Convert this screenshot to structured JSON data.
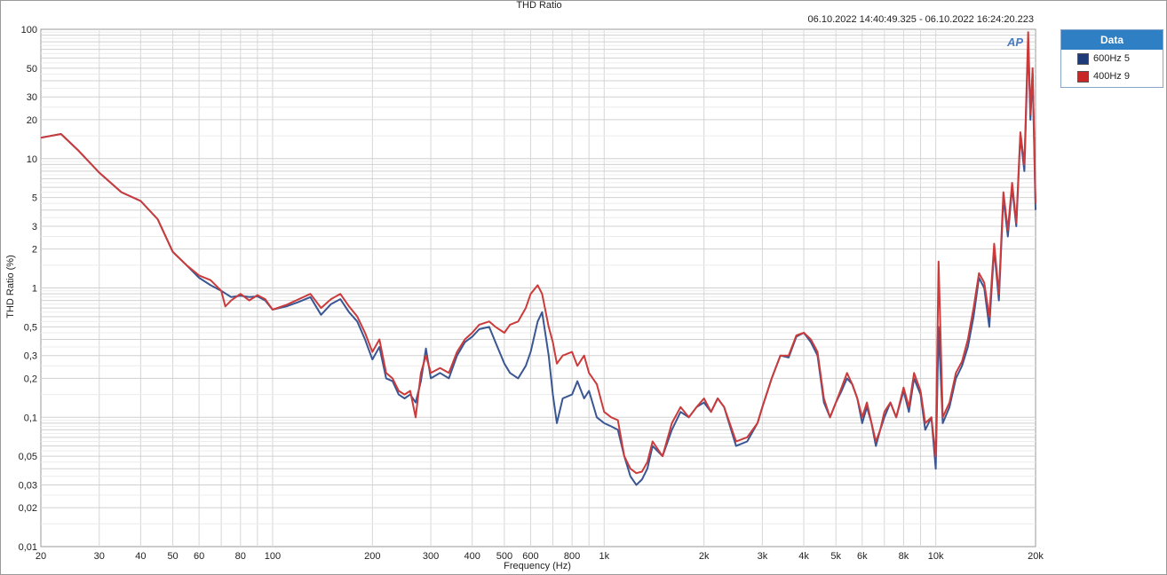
{
  "colors": {
    "series_blue": "#3a5693",
    "series_red": "#cc3b3b",
    "legend_header": "#2e7fc4"
  },
  "window": {
    "title": "THD Ratio",
    "date_range": "06.10.2022 14:40:49.325 - 06.10.2022 16:24:20.223"
  },
  "legend": {
    "title": "Data",
    "items": [
      {
        "label": "600Hz 5",
        "color": "#1f3b7a"
      },
      {
        "label": "400Hz 9",
        "color": "#c82828"
      }
    ]
  },
  "logo": "AP",
  "chart_data": {
    "type": "line",
    "title": "THD Ratio",
    "xlabel": "Frequency (Hz)",
    "ylabel": "THD Ratio (%)",
    "xscale": "log",
    "yscale": "log",
    "xlim": [
      20,
      20000
    ],
    "ylim": [
      0.01,
      100
    ],
    "grid": true,
    "legend_position": "right",
    "xticks": [
      {
        "value": 20,
        "label": "20"
      },
      {
        "value": 30,
        "label": "30"
      },
      {
        "value": 40,
        "label": "40"
      },
      {
        "value": 50,
        "label": "50"
      },
      {
        "value": 60,
        "label": "60"
      },
      {
        "value": 80,
        "label": "80"
      },
      {
        "value": 100,
        "label": "100"
      },
      {
        "value": 200,
        "label": "200"
      },
      {
        "value": 300,
        "label": "300"
      },
      {
        "value": 400,
        "label": "400"
      },
      {
        "value": 500,
        "label": "500"
      },
      {
        "value": 600,
        "label": "600"
      },
      {
        "value": 800,
        "label": "800"
      },
      {
        "value": 1000,
        "label": "1k"
      },
      {
        "value": 2000,
        "label": "2k"
      },
      {
        "value": 3000,
        "label": "3k"
      },
      {
        "value": 4000,
        "label": "4k"
      },
      {
        "value": 5000,
        "label": "5k"
      },
      {
        "value": 6000,
        "label": "6k"
      },
      {
        "value": 8000,
        "label": "8k"
      },
      {
        "value": 10000,
        "label": "10k"
      },
      {
        "value": 20000,
        "label": "20k"
      }
    ],
    "yticks": [
      {
        "value": 100,
        "label": "100"
      },
      {
        "value": 50,
        "label": "50"
      },
      {
        "value": 30,
        "label": "30"
      },
      {
        "value": 20,
        "label": "20"
      },
      {
        "value": 10,
        "label": "10"
      },
      {
        "value": 5,
        "label": "5"
      },
      {
        "value": 3,
        "label": "3"
      },
      {
        "value": 2,
        "label": "2"
      },
      {
        "value": 1,
        "label": "1"
      },
      {
        "value": 0.5,
        "label": "0,5"
      },
      {
        "value": 0.3,
        "label": "0,3"
      },
      {
        "value": 0.2,
        "label": "0,2"
      },
      {
        "value": 0.1,
        "label": "0,1"
      },
      {
        "value": 0.05,
        "label": "0,05"
      },
      {
        "value": 0.03,
        "label": "0,03"
      },
      {
        "value": 0.02,
        "label": "0,02"
      },
      {
        "value": 0.01,
        "label": "0,01"
      }
    ],
    "series": [
      {
        "name": "600Hz 5",
        "color": "#3a5693",
        "points": [
          [
            20,
            14.5
          ],
          [
            23,
            15.5
          ],
          [
            26,
            11.5
          ],
          [
            30,
            7.8
          ],
          [
            35,
            5.5
          ],
          [
            40,
            4.7
          ],
          [
            45,
            3.4
          ],
          [
            50,
            1.9
          ],
          [
            55,
            1.5
          ],
          [
            60,
            1.2
          ],
          [
            65,
            1.05
          ],
          [
            70,
            0.95
          ],
          [
            75,
            0.85
          ],
          [
            80,
            0.87
          ],
          [
            85,
            0.85
          ],
          [
            90,
            0.86
          ],
          [
            95,
            0.8
          ],
          [
            100,
            0.68
          ],
          [
            110,
            0.72
          ],
          [
            120,
            0.78
          ],
          [
            130,
            0.85
          ],
          [
            140,
            0.62
          ],
          [
            150,
            0.75
          ],
          [
            160,
            0.82
          ],
          [
            170,
            0.65
          ],
          [
            180,
            0.55
          ],
          [
            190,
            0.4
          ],
          [
            200,
            0.28
          ],
          [
            210,
            0.35
          ],
          [
            220,
            0.2
          ],
          [
            230,
            0.19
          ],
          [
            240,
            0.15
          ],
          [
            250,
            0.14
          ],
          [
            260,
            0.15
          ],
          [
            270,
            0.13
          ],
          [
            280,
            0.19
          ],
          [
            290,
            0.34
          ],
          [
            300,
            0.2
          ],
          [
            320,
            0.22
          ],
          [
            340,
            0.2
          ],
          [
            360,
            0.3
          ],
          [
            380,
            0.38
          ],
          [
            400,
            0.42
          ],
          [
            420,
            0.48
          ],
          [
            450,
            0.5
          ],
          [
            470,
            0.38
          ],
          [
            500,
            0.26
          ],
          [
            520,
            0.22
          ],
          [
            550,
            0.2
          ],
          [
            580,
            0.25
          ],
          [
            600,
            0.32
          ],
          [
            630,
            0.55
          ],
          [
            650,
            0.65
          ],
          [
            680,
            0.3
          ],
          [
            700,
            0.15
          ],
          [
            720,
            0.09
          ],
          [
            750,
            0.14
          ],
          [
            800,
            0.15
          ],
          [
            830,
            0.19
          ],
          [
            870,
            0.14
          ],
          [
            900,
            0.16
          ],
          [
            950,
            0.1
          ],
          [
            1000,
            0.09
          ],
          [
            1050,
            0.085
          ],
          [
            1100,
            0.08
          ],
          [
            1150,
            0.05
          ],
          [
            1200,
            0.035
          ],
          [
            1250,
            0.03
          ],
          [
            1300,
            0.033
          ],
          [
            1350,
            0.04
          ],
          [
            1400,
            0.06
          ],
          [
            1500,
            0.05
          ],
          [
            1600,
            0.08
          ],
          [
            1700,
            0.11
          ],
          [
            1800,
            0.1
          ],
          [
            1900,
            0.12
          ],
          [
            2000,
            0.13
          ],
          [
            2100,
            0.11
          ],
          [
            2200,
            0.14
          ],
          [
            2300,
            0.12
          ],
          [
            2500,
            0.06
          ],
          [
            2700,
            0.065
          ],
          [
            2900,
            0.09
          ],
          [
            3000,
            0.12
          ],
          [
            3200,
            0.2
          ],
          [
            3400,
            0.3
          ],
          [
            3600,
            0.29
          ],
          [
            3800,
            0.42
          ],
          [
            4000,
            0.45
          ],
          [
            4200,
            0.38
          ],
          [
            4400,
            0.3
          ],
          [
            4600,
            0.13
          ],
          [
            4800,
            0.1
          ],
          [
            5000,
            0.13
          ],
          [
            5200,
            0.16
          ],
          [
            5400,
            0.2
          ],
          [
            5600,
            0.18
          ],
          [
            5800,
            0.14
          ],
          [
            6000,
            0.09
          ],
          [
            6200,
            0.12
          ],
          [
            6400,
            0.09
          ],
          [
            6600,
            0.06
          ],
          [
            6800,
            0.08
          ],
          [
            7000,
            0.1
          ],
          [
            7300,
            0.13
          ],
          [
            7600,
            0.1
          ],
          [
            8000,
            0.16
          ],
          [
            8300,
            0.11
          ],
          [
            8600,
            0.2
          ],
          [
            9000,
            0.15
          ],
          [
            9300,
            0.08
          ],
          [
            9700,
            0.1
          ],
          [
            10000,
            0.04
          ],
          [
            10200,
            0.5
          ],
          [
            10500,
            0.09
          ],
          [
            11000,
            0.12
          ],
          [
            11500,
            0.2
          ],
          [
            12000,
            0.25
          ],
          [
            12500,
            0.35
          ],
          [
            13000,
            0.6
          ],
          [
            13500,
            1.2
          ],
          [
            14000,
            1.0
          ],
          [
            14500,
            0.5
          ],
          [
            15000,
            2.0
          ],
          [
            15500,
            0.8
          ],
          [
            16000,
            5.0
          ],
          [
            16500,
            2.5
          ],
          [
            17000,
            6.0
          ],
          [
            17500,
            3.0
          ],
          [
            18000,
            15.0
          ],
          [
            18500,
            8.0
          ],
          [
            19000,
            80.0
          ],
          [
            19300,
            20.0
          ],
          [
            19600,
            45.0
          ],
          [
            20000,
            4.0
          ]
        ]
      },
      {
        "name": "400Hz 9",
        "color": "#cc3b3b",
        "points": [
          [
            20,
            14.5
          ],
          [
            23,
            15.5
          ],
          [
            26,
            11.5
          ],
          [
            30,
            7.8
          ],
          [
            35,
            5.5
          ],
          [
            40,
            4.7
          ],
          [
            45,
            3.4
          ],
          [
            50,
            1.9
          ],
          [
            55,
            1.5
          ],
          [
            60,
            1.25
          ],
          [
            65,
            1.15
          ],
          [
            70,
            0.95
          ],
          [
            72,
            0.72
          ],
          [
            75,
            0.8
          ],
          [
            80,
            0.9
          ],
          [
            85,
            0.8
          ],
          [
            90,
            0.88
          ],
          [
            95,
            0.82
          ],
          [
            100,
            0.68
          ],
          [
            110,
            0.74
          ],
          [
            120,
            0.82
          ],
          [
            130,
            0.9
          ],
          [
            140,
            0.7
          ],
          [
            150,
            0.82
          ],
          [
            160,
            0.9
          ],
          [
            170,
            0.72
          ],
          [
            180,
            0.6
          ],
          [
            190,
            0.45
          ],
          [
            200,
            0.32
          ],
          [
            210,
            0.4
          ],
          [
            220,
            0.22
          ],
          [
            230,
            0.2
          ],
          [
            240,
            0.16
          ],
          [
            250,
            0.15
          ],
          [
            260,
            0.16
          ],
          [
            270,
            0.1
          ],
          [
            280,
            0.22
          ],
          [
            290,
            0.3
          ],
          [
            300,
            0.22
          ],
          [
            320,
            0.24
          ],
          [
            340,
            0.22
          ],
          [
            360,
            0.32
          ],
          [
            380,
            0.4
          ],
          [
            400,
            0.45
          ],
          [
            420,
            0.52
          ],
          [
            450,
            0.55
          ],
          [
            470,
            0.5
          ],
          [
            500,
            0.45
          ],
          [
            520,
            0.52
          ],
          [
            550,
            0.55
          ],
          [
            580,
            0.7
          ],
          [
            600,
            0.9
          ],
          [
            630,
            1.05
          ],
          [
            650,
            0.9
          ],
          [
            680,
            0.5
          ],
          [
            700,
            0.38
          ],
          [
            720,
            0.26
          ],
          [
            750,
            0.3
          ],
          [
            800,
            0.32
          ],
          [
            830,
            0.25
          ],
          [
            870,
            0.3
          ],
          [
            900,
            0.22
          ],
          [
            950,
            0.18
          ],
          [
            1000,
            0.11
          ],
          [
            1050,
            0.1
          ],
          [
            1100,
            0.095
          ],
          [
            1150,
            0.05
          ],
          [
            1200,
            0.04
          ],
          [
            1250,
            0.037
          ],
          [
            1300,
            0.038
          ],
          [
            1350,
            0.045
          ],
          [
            1400,
            0.065
          ],
          [
            1500,
            0.05
          ],
          [
            1600,
            0.09
          ],
          [
            1700,
            0.12
          ],
          [
            1800,
            0.1
          ],
          [
            1900,
            0.12
          ],
          [
            2000,
            0.14
          ],
          [
            2100,
            0.11
          ],
          [
            2200,
            0.14
          ],
          [
            2300,
            0.12
          ],
          [
            2500,
            0.065
          ],
          [
            2700,
            0.07
          ],
          [
            2900,
            0.09
          ],
          [
            3000,
            0.12
          ],
          [
            3200,
            0.2
          ],
          [
            3400,
            0.3
          ],
          [
            3600,
            0.3
          ],
          [
            3800,
            0.43
          ],
          [
            4000,
            0.45
          ],
          [
            4200,
            0.4
          ],
          [
            4400,
            0.32
          ],
          [
            4600,
            0.14
          ],
          [
            4800,
            0.1
          ],
          [
            5000,
            0.13
          ],
          [
            5200,
            0.17
          ],
          [
            5400,
            0.22
          ],
          [
            5600,
            0.18
          ],
          [
            5800,
            0.14
          ],
          [
            6000,
            0.1
          ],
          [
            6200,
            0.13
          ],
          [
            6400,
            0.09
          ],
          [
            6600,
            0.065
          ],
          [
            6800,
            0.08
          ],
          [
            7000,
            0.11
          ],
          [
            7300,
            0.13
          ],
          [
            7600,
            0.1
          ],
          [
            8000,
            0.17
          ],
          [
            8300,
            0.12
          ],
          [
            8600,
            0.22
          ],
          [
            9000,
            0.16
          ],
          [
            9300,
            0.09
          ],
          [
            9700,
            0.1
          ],
          [
            10000,
            0.05
          ],
          [
            10200,
            1.6
          ],
          [
            10500,
            0.1
          ],
          [
            11000,
            0.13
          ],
          [
            11500,
            0.22
          ],
          [
            12000,
            0.27
          ],
          [
            12500,
            0.4
          ],
          [
            13000,
            0.7
          ],
          [
            13500,
            1.3
          ],
          [
            14000,
            1.1
          ],
          [
            14500,
            0.6
          ],
          [
            15000,
            2.2
          ],
          [
            15500,
            0.9
          ],
          [
            16000,
            5.5
          ],
          [
            16500,
            2.8
          ],
          [
            17000,
            6.5
          ],
          [
            17500,
            3.2
          ],
          [
            18000,
            16.0
          ],
          [
            18500,
            9.0
          ],
          [
            19000,
            95.0
          ],
          [
            19300,
            22.0
          ],
          [
            19600,
            50.0
          ],
          [
            20000,
            4.5
          ]
        ]
      }
    ]
  }
}
